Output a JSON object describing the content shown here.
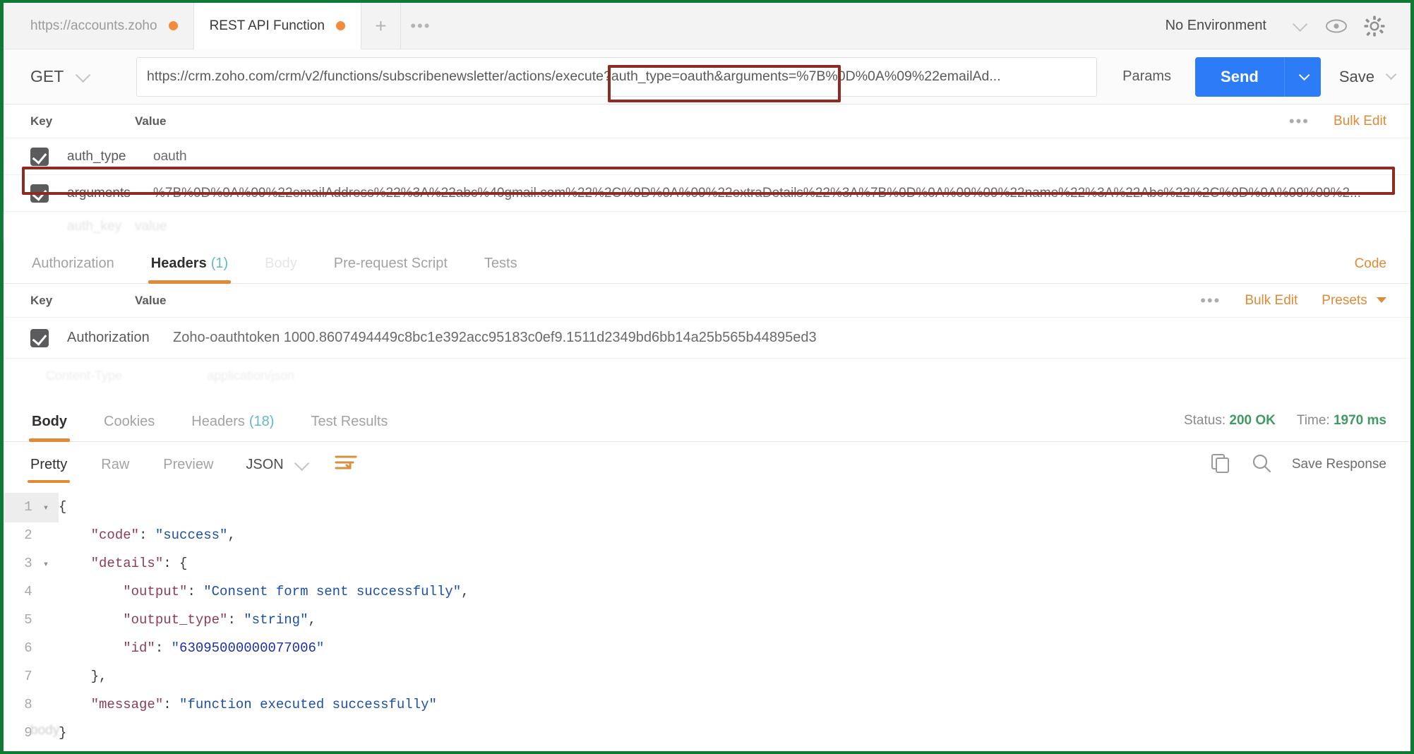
{
  "window": {
    "accent_green": "#0e7a34",
    "annotation_red": "#8e2b23"
  },
  "tabbar": {
    "tabs": [
      {
        "label": "https://accounts.zoho",
        "unsaved": true,
        "active": false
      },
      {
        "label": "REST API Function",
        "unsaved": true,
        "active": true
      }
    ],
    "new_tab_icon": "plus-icon",
    "more_icon": "ellipsis-icon",
    "environment": "No Environment",
    "environment_caret_icon": "chevron-down-icon",
    "eye_icon": "eye-icon",
    "settings_icon": "gear-icon"
  },
  "request": {
    "method": "GET",
    "method_caret_icon": "chevron-down-icon",
    "url": "https://crm.zoho.com/crm/v2/functions/subscribenewsletter/actions/execute?auth_type=oauth&arguments=%7B%0D%0A%09%22emailAd...",
    "params_label": "Params",
    "send_label": "Send",
    "send_caret_icon": "chevron-down-icon",
    "save_label": "Save",
    "save_caret_icon": "chevron-down-icon",
    "send_color": "#2b7cf6"
  },
  "params_table": {
    "col_key": "Key",
    "col_value": "Value",
    "more_icon": "ellipsis-icon",
    "bulk_edit": "Bulk Edit",
    "rows": [
      {
        "checked": true,
        "key": "auth_type",
        "value": "oauth",
        "highlighted": false
      },
      {
        "checked": true,
        "key": "arguments",
        "value": "%7B%0D%0A%09%22emailAddress%22%3A%22abc%40gmail.com%22%2C%0D%0A%09%22extraDetails%22%3A%7B%0D%0A%09%09%22name%22%3A%22Abc%22%2C%0D%0A%09%09%2...",
        "highlighted": true
      }
    ],
    "ghost_row": {
      "key": "auth_key",
      "value": "value"
    }
  },
  "request_tabs": {
    "items": [
      {
        "label": "Authorization",
        "count": "",
        "active": false,
        "faded": false
      },
      {
        "label": "Headers",
        "count": "(1)",
        "active": true,
        "faded": false
      },
      {
        "label": "Body",
        "count": "",
        "active": false,
        "faded": true
      },
      {
        "label": "Pre-request Script",
        "count": "",
        "active": false,
        "faded": false
      },
      {
        "label": "Tests",
        "count": "",
        "active": false,
        "faded": false
      }
    ],
    "code_link": "Code"
  },
  "headers_table": {
    "col_key": "Key",
    "col_value": "Value",
    "more_icon": "ellipsis-icon",
    "bulk_edit": "Bulk Edit",
    "presets": "Presets",
    "presets_caret_icon": "chevron-down-icon",
    "rows": [
      {
        "checked": true,
        "key": "Authorization",
        "value": "Zoho-oauthtoken 1000.8607494449c8bc1e392acc95183c0ef9.1511d2349bd6bb14a25b565b44895ed3"
      }
    ]
  },
  "response_tabs": {
    "items": [
      {
        "label": "Body",
        "count": "",
        "active": true
      },
      {
        "label": "Cookies",
        "count": "",
        "active": false
      },
      {
        "label": "Headers",
        "count": "(18)",
        "active": false
      },
      {
        "label": "Test Results",
        "count": "",
        "active": false
      }
    ],
    "status_label": "Status:",
    "status_value": "200 OK",
    "time_label": "Time:",
    "time_value": "1970 ms",
    "status_color": "#3f9b62"
  },
  "body_toolbar": {
    "views": [
      {
        "label": "Pretty",
        "active": true
      },
      {
        "label": "Raw",
        "active": false
      },
      {
        "label": "Preview",
        "active": false
      }
    ],
    "format": "JSON",
    "format_caret_icon": "chevron-down-icon",
    "wrap_icon": "word-wrap-icon",
    "copy_icon": "copy-icon",
    "search_icon": "search-icon",
    "save_response": "Save Response"
  },
  "response_body": {
    "lines": [
      {
        "n": "1",
        "fold": true,
        "indent": 0,
        "segments": [
          {
            "t": "{",
            "c": "p"
          }
        ]
      },
      {
        "n": "2",
        "fold": false,
        "indent": 1,
        "segments": [
          {
            "t": "\"code\"",
            "c": "k"
          },
          {
            "t": ": ",
            "c": "p"
          },
          {
            "t": "\"success\"",
            "c": "s"
          },
          {
            "t": ",",
            "c": "p"
          }
        ]
      },
      {
        "n": "3",
        "fold": true,
        "indent": 1,
        "segments": [
          {
            "t": "\"details\"",
            "c": "k"
          },
          {
            "t": ": {",
            "c": "p"
          }
        ]
      },
      {
        "n": "4",
        "fold": false,
        "indent": 2,
        "segments": [
          {
            "t": "\"output\"",
            "c": "k"
          },
          {
            "t": ": ",
            "c": "p"
          },
          {
            "t": "\"Consent form sent successfully\"",
            "c": "s"
          },
          {
            "t": ",",
            "c": "p"
          }
        ]
      },
      {
        "n": "5",
        "fold": false,
        "indent": 2,
        "segments": [
          {
            "t": "\"output_type\"",
            "c": "k"
          },
          {
            "t": ": ",
            "c": "p"
          },
          {
            "t": "\"string\"",
            "c": "s"
          },
          {
            "t": ",",
            "c": "p"
          }
        ]
      },
      {
        "n": "6",
        "fold": false,
        "indent": 2,
        "segments": [
          {
            "t": "\"id\"",
            "c": "k"
          },
          {
            "t": ": ",
            "c": "p"
          },
          {
            "t": "\"",
            "c": "s"
          },
          {
            "t": "63095000000077006",
            "c": "num"
          },
          {
            "t": "\"",
            "c": "s"
          }
        ]
      },
      {
        "n": "7",
        "fold": false,
        "indent": 1,
        "segments": [
          {
            "t": "},",
            "c": "p"
          }
        ]
      },
      {
        "n": "8",
        "fold": false,
        "indent": 1,
        "segments": [
          {
            "t": "\"message\"",
            "c": "k"
          },
          {
            "t": ": ",
            "c": "p"
          },
          {
            "t": "\"function executed successfully\"",
            "c": "s"
          }
        ]
      },
      {
        "n": "9",
        "fold": false,
        "indent": 0,
        "segments": [
          {
            "t": "}",
            "c": "p"
          }
        ]
      }
    ]
  }
}
